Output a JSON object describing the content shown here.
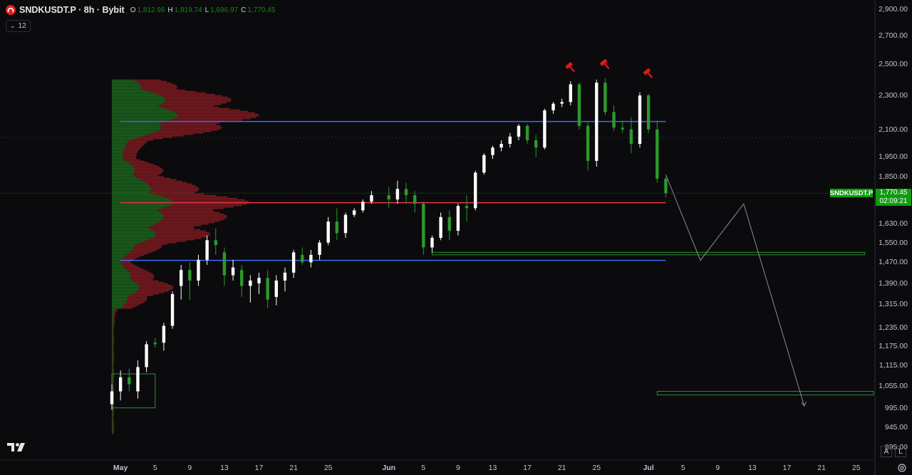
{
  "header": {
    "title": "SNDKUSDT.P · 8h · Bybit",
    "ohlc": [
      {
        "k": "O",
        "v": "1,812.96"
      },
      {
        "k": "H",
        "v": "1,819.74"
      },
      {
        "k": "L",
        "v": "1,696.97"
      },
      {
        "k": "C",
        "v": "1,770.45"
      }
    ],
    "indicator_count": "12"
  },
  "price_tag": {
    "symbol": "SNDKUSDT.P",
    "price": "1,770.45",
    "countdown": "02:09:21"
  },
  "price_axis": [
    {
      "label": "2,900.00",
      "v": 2900
    },
    {
      "label": "2,700.00",
      "v": 2700
    },
    {
      "label": "2,500.00",
      "v": 2500
    },
    {
      "label": "2,300.00",
      "v": 2300
    },
    {
      "label": "2,100.00",
      "v": 2100
    },
    {
      "label": "1,950.00",
      "v": 1950
    },
    {
      "label": "1,850.00",
      "v": 1850
    },
    {
      "label": "1,630.00",
      "v": 1630
    },
    {
      "label": "1,550.00",
      "v": 1550
    },
    {
      "label": "1,470.00",
      "v": 1470
    },
    {
      "label": "1,390.00",
      "v": 1390
    },
    {
      "label": "1,315.00",
      "v": 1315
    },
    {
      "label": "1,235.00",
      "v": 1235
    },
    {
      "label": "1,175.00",
      "v": 1175
    },
    {
      "label": "1,115.00",
      "v": 1115
    },
    {
      "label": "1,055.00",
      "v": 1055
    },
    {
      "label": "995.00",
      "v": 995
    },
    {
      "label": "945.00",
      "v": 945
    },
    {
      "label": "895.00",
      "v": 895
    }
  ],
  "date_axis": [
    {
      "label": "May",
      "d": "2025-05-01"
    },
    {
      "label": "5",
      "d": "2025-05-05"
    },
    {
      "label": "9",
      "d": "2025-05-09"
    },
    {
      "label": "13",
      "d": "2025-05-13"
    },
    {
      "label": "17",
      "d": "2025-05-17"
    },
    {
      "label": "21",
      "d": "2025-05-21"
    },
    {
      "label": "25",
      "d": "2025-05-25"
    },
    {
      "label": "Jun",
      "d": "2025-06-01"
    },
    {
      "label": "5",
      "d": "2025-06-05"
    },
    {
      "label": "9",
      "d": "2025-06-09"
    },
    {
      "label": "13",
      "d": "2025-06-13"
    },
    {
      "label": "17",
      "d": "2025-06-17"
    },
    {
      "label": "21",
      "d": "2025-06-21"
    },
    {
      "label": "25",
      "d": "2025-06-25"
    },
    {
      "label": "Jul",
      "d": "2025-07-01"
    },
    {
      "label": "5",
      "d": "2025-07-05"
    },
    {
      "label": "9",
      "d": "2025-07-09"
    },
    {
      "label": "13",
      "d": "2025-07-13"
    },
    {
      "label": "17",
      "d": "2025-07-17"
    },
    {
      "label": "21",
      "d": "2025-07-21"
    },
    {
      "label": "25",
      "d": "2025-07-25"
    }
  ],
  "buttons": {
    "auto": "A",
    "log": "L"
  },
  "colors": {
    "bg": "#0b0b0d",
    "up": "#ffffff",
    "down": "#2c9a2c",
    "blue_line": "#3d6df2",
    "red_line": "#f23645",
    "zone": "#2f8f2f",
    "hammer": "#e11919",
    "tag": "#0f9d0f"
  },
  "chart_data": {
    "type": "candlestick",
    "timeframe": "8h",
    "scale": "log",
    "x_range": [
      "2025-04-30",
      "2025-07-27"
    ],
    "y_range": [
      870,
      2960
    ],
    "candles": [
      [
        "2025-04-30",
        1005,
        1060,
        990,
        1040
      ],
      [
        "2025-05-01",
        1040,
        1100,
        1015,
        1080
      ],
      [
        "2025-05-02",
        1080,
        1105,
        1040,
        1060
      ],
      [
        "2025-05-03",
        1040,
        1130,
        1020,
        1110
      ],
      [
        "2025-05-04",
        1110,
        1190,
        1095,
        1180
      ],
      [
        "2025-05-05",
        1185,
        1200,
        1170,
        1180
      ],
      [
        "2025-05-06",
        1185,
        1250,
        1160,
        1240
      ],
      [
        "2025-05-07",
        1240,
        1360,
        1230,
        1350
      ],
      [
        "2025-05-08",
        1380,
        1460,
        1330,
        1440
      ],
      [
        "2025-05-09",
        1440,
        1470,
        1330,
        1400
      ],
      [
        "2025-05-10",
        1400,
        1500,
        1380,
        1480
      ],
      [
        "2025-05-11",
        1480,
        1580,
        1460,
        1560
      ],
      [
        "2025-05-12",
        1560,
        1610,
        1500,
        1540
      ],
      [
        "2025-05-13",
        1510,
        1530,
        1380,
        1420
      ],
      [
        "2025-05-14",
        1420,
        1480,
        1400,
        1450
      ],
      [
        "2025-05-15",
        1440,
        1460,
        1340,
        1380
      ],
      [
        "2025-05-16",
        1380,
        1420,
        1320,
        1400
      ],
      [
        "2025-05-17",
        1390,
        1430,
        1350,
        1410
      ],
      [
        "2025-05-18",
        1410,
        1440,
        1300,
        1330
      ],
      [
        "2025-05-19",
        1340,
        1420,
        1310,
        1400
      ],
      [
        "2025-05-20",
        1400,
        1450,
        1360,
        1430
      ],
      [
        "2025-05-21",
        1430,
        1520,
        1410,
        1510
      ],
      [
        "2025-05-22",
        1500,
        1530,
        1460,
        1470
      ],
      [
        "2025-05-23",
        1470,
        1520,
        1450,
        1500
      ],
      [
        "2025-05-24",
        1500,
        1560,
        1480,
        1550
      ],
      [
        "2025-05-25",
        1550,
        1660,
        1540,
        1640
      ],
      [
        "2025-05-26",
        1640,
        1700,
        1560,
        1590
      ],
      [
        "2025-05-27",
        1590,
        1680,
        1570,
        1670
      ],
      [
        "2025-05-28",
        1670,
        1700,
        1660,
        1690
      ],
      [
        "2025-05-29",
        1690,
        1740,
        1680,
        1730
      ],
      [
        "2025-05-30",
        1730,
        1780,
        1720,
        1760
      ],
      [
        "2025-06-01",
        1760,
        1800,
        1700,
        1740
      ],
      [
        "2025-06-02",
        1740,
        1830,
        1720,
        1790
      ],
      [
        "2025-06-03",
        1790,
        1820,
        1720,
        1760
      ],
      [
        "2025-06-04",
        1760,
        1780,
        1680,
        1720
      ],
      [
        "2025-06-05",
        1720,
        1730,
        1500,
        1530
      ],
      [
        "2025-06-06",
        1530,
        1580,
        1510,
        1570
      ],
      [
        "2025-06-07",
        1570,
        1680,
        1560,
        1660
      ],
      [
        "2025-06-08",
        1660,
        1690,
        1560,
        1600
      ],
      [
        "2025-06-09",
        1600,
        1720,
        1580,
        1710
      ],
      [
        "2025-06-10",
        1710,
        1760,
        1640,
        1700
      ],
      [
        "2025-06-11",
        1700,
        1880,
        1690,
        1870
      ],
      [
        "2025-06-12",
        1870,
        1970,
        1860,
        1960
      ],
      [
        "2025-06-13",
        1960,
        2010,
        1940,
        2000
      ],
      [
        "2025-06-14",
        2000,
        2040,
        1980,
        2020
      ],
      [
        "2025-06-15",
        2020,
        2080,
        2000,
        2060
      ],
      [
        "2025-06-16",
        2060,
        2130,
        2040,
        2120
      ],
      [
        "2025-06-17",
        2120,
        2130,
        2020,
        2040
      ],
      [
        "2025-06-18",
        2040,
        2070,
        1950,
        2000
      ],
      [
        "2025-06-19",
        2000,
        2220,
        1990,
        2210
      ],
      [
        "2025-06-20",
        2210,
        2260,
        2190,
        2250
      ],
      [
        "2025-06-21",
        2250,
        2280,
        2230,
        2260
      ],
      [
        "2025-06-22",
        2260,
        2390,
        2240,
        2370
      ],
      [
        "2025-06-23",
        2370,
        2380,
        2100,
        2120
      ],
      [
        "2025-06-24",
        2120,
        2140,
        1880,
        1930
      ],
      [
        "2025-06-25",
        1930,
        2400,
        1900,
        2380
      ],
      [
        "2025-06-26",
        2380,
        2410,
        2180,
        2200
      ],
      [
        "2025-06-27",
        2200,
        2240,
        2090,
        2110
      ],
      [
        "2025-06-28",
        2110,
        2150,
        2080,
        2100
      ],
      [
        "2025-06-29",
        2100,
        2170,
        1970,
        2020
      ],
      [
        "2025-06-30",
        2020,
        2320,
        2000,
        2300
      ],
      [
        "2025-07-01",
        2300,
        2310,
        2080,
        2100
      ],
      [
        "2025-07-02",
        2100,
        2150,
        1820,
        1840
      ],
      [
        "2025-07-03",
        1840,
        1850,
        1750,
        1770
      ]
    ],
    "hlines": [
      {
        "price": 2145,
        "color": "blue",
        "from": "2025-05-01",
        "to": "2025-07-03"
      },
      {
        "price": 1725,
        "color": "red",
        "from": "2025-05-01",
        "to": "2025-07-03"
      },
      {
        "price": 1478,
        "color": "blue",
        "from": "2025-05-01",
        "to": "2025-07-03"
      }
    ],
    "zones": [
      {
        "from": "2025-04-30",
        "to": "2025-05-05",
        "top": 1090,
        "bottom": 995
      },
      {
        "from": "2025-06-06",
        "to": "2025-07-26",
        "top": 1510,
        "bottom": 1500
      },
      {
        "from": "2025-07-02",
        "to": "2025-07-27",
        "top": 1040,
        "bottom": 1030
      }
    ],
    "projection": [
      [
        "2025-07-03",
        1860
      ],
      [
        "2025-07-07",
        1478
      ],
      [
        "2025-07-12",
        1720
      ],
      [
        "2025-07-19",
        1000
      ]
    ],
    "markers": [
      {
        "type": "hammer",
        "date": "2025-06-22",
        "price": 2480
      },
      {
        "type": "hammer",
        "date": "2025-06-26",
        "price": 2500
      },
      {
        "type": "hammer",
        "date": "2025-07-01",
        "price": 2440
      }
    ],
    "volume_profile": {
      "price_range": [
        930,
        2400
      ],
      "peaks": [
        {
          "price": 2150,
          "width": 1.0
        },
        {
          "price": 2300,
          "width": 0.7
        },
        {
          "price": 1725,
          "width": 1.0
        },
        {
          "price": 1590,
          "width": 0.7
        },
        {
          "price": 1380,
          "width": 0.45
        },
        {
          "price": 1870,
          "width": 0.35
        }
      ]
    }
  }
}
